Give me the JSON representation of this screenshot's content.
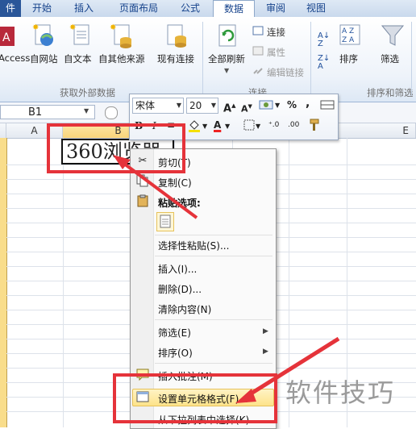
{
  "ribbon": {
    "tabs": [
      {
        "label": "件",
        "kind": "file"
      },
      {
        "label": "开始"
      },
      {
        "label": "插入"
      },
      {
        "label": "页面布局"
      },
      {
        "label": "公式"
      },
      {
        "label": "数据",
        "active": true
      },
      {
        "label": "审阅"
      },
      {
        "label": "视图"
      }
    ],
    "groups": {
      "external_data": {
        "label": "获取外部数据",
        "buttons": [
          "Access",
          "自网站",
          "自文本",
          "自其他来源",
          "现有连接"
        ]
      },
      "connections": {
        "label": "连接",
        "refresh_all": "全部刷新",
        "items": [
          "连接",
          "属性",
          "编辑链接"
        ]
      },
      "sort_filter": {
        "label": "排序和筛选",
        "sort": "排序",
        "filter": "筛选"
      }
    }
  },
  "formula_bar": {
    "name_box": "B1"
  },
  "sheet": {
    "columns": [
      "A",
      "B",
      "E"
    ],
    "cell_b1": "360浏览器"
  },
  "mini_toolbar": {
    "font_name": "宋体",
    "font_size": "20",
    "bold": "B",
    "italic": "I",
    "percent": "%",
    "comma": ","
  },
  "context_menu": {
    "items": {
      "cut": "剪切(T)",
      "copy": "复制(C)",
      "paste_options": "粘贴选项:",
      "paste_special": "选择性粘贴(S)...",
      "insert": "插入(I)...",
      "delete": "删除(D)...",
      "clear": "清除内容(N)",
      "filter": "筛选(E)",
      "sort": "排序(O)",
      "insert_comment": "插入批注(M)",
      "format_cells": "设置单元格格式(F)...",
      "pick_from_list": "从下拉列表中选择(K)..."
    }
  },
  "watermark": "软件技巧",
  "colors": {
    "annotation_red": "#e5333a",
    "menu_highlight": "#fde38a",
    "file_tab": "#2a5699"
  }
}
